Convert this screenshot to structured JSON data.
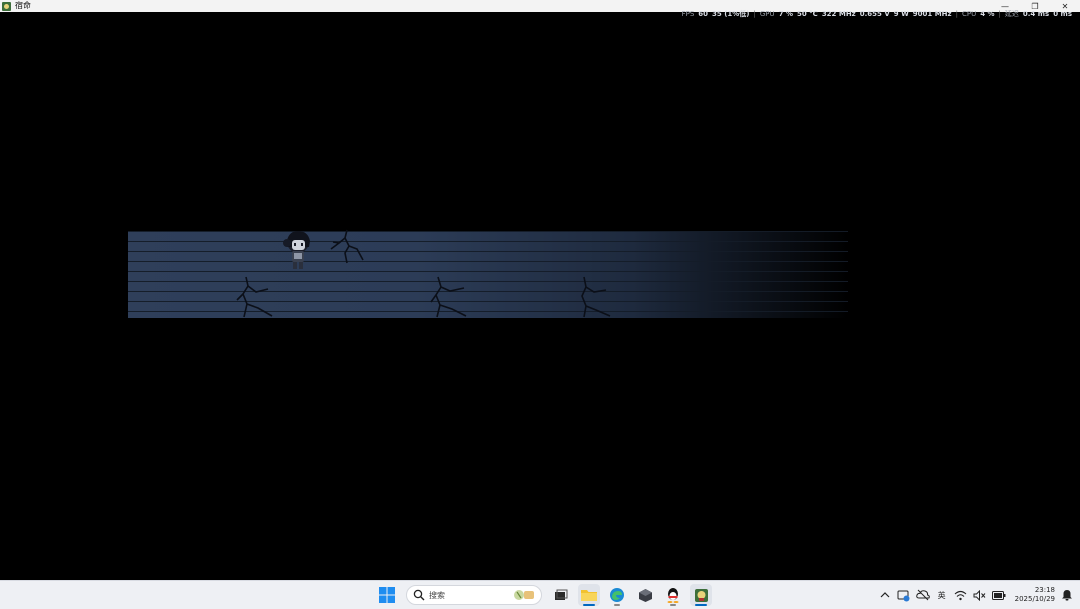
{
  "window": {
    "title": "宿命",
    "controls": {
      "minimize": "—",
      "restore": "❐",
      "close": "✕"
    }
  },
  "overlay": {
    "fps_label": "FPS",
    "fps_value": "60",
    "fps_low": "35 (1%低)",
    "gpu_label": "GPU",
    "gpu_usage": "7 %",
    "gpu_temp": "50 °C",
    "gpu_clock": "322 MHz",
    "gpu_voltage": "0.655 V",
    "gpu_power": "9 W",
    "gpu_mem_clock": "9001 MHz",
    "cpu_label": "CPU",
    "cpu_usage": "4 %",
    "latency_label": "延迟",
    "latency_value": "0.4 ms",
    "latency_value2": "0 ms"
  },
  "taskbar": {
    "search_placeholder": "搜索",
    "input_method": "英",
    "time": "23:18",
    "date": "2025/10/29"
  },
  "colors": {
    "floor": "#2f3f5a",
    "taskbar": "#eef0f4",
    "accent": "#0067c0"
  }
}
